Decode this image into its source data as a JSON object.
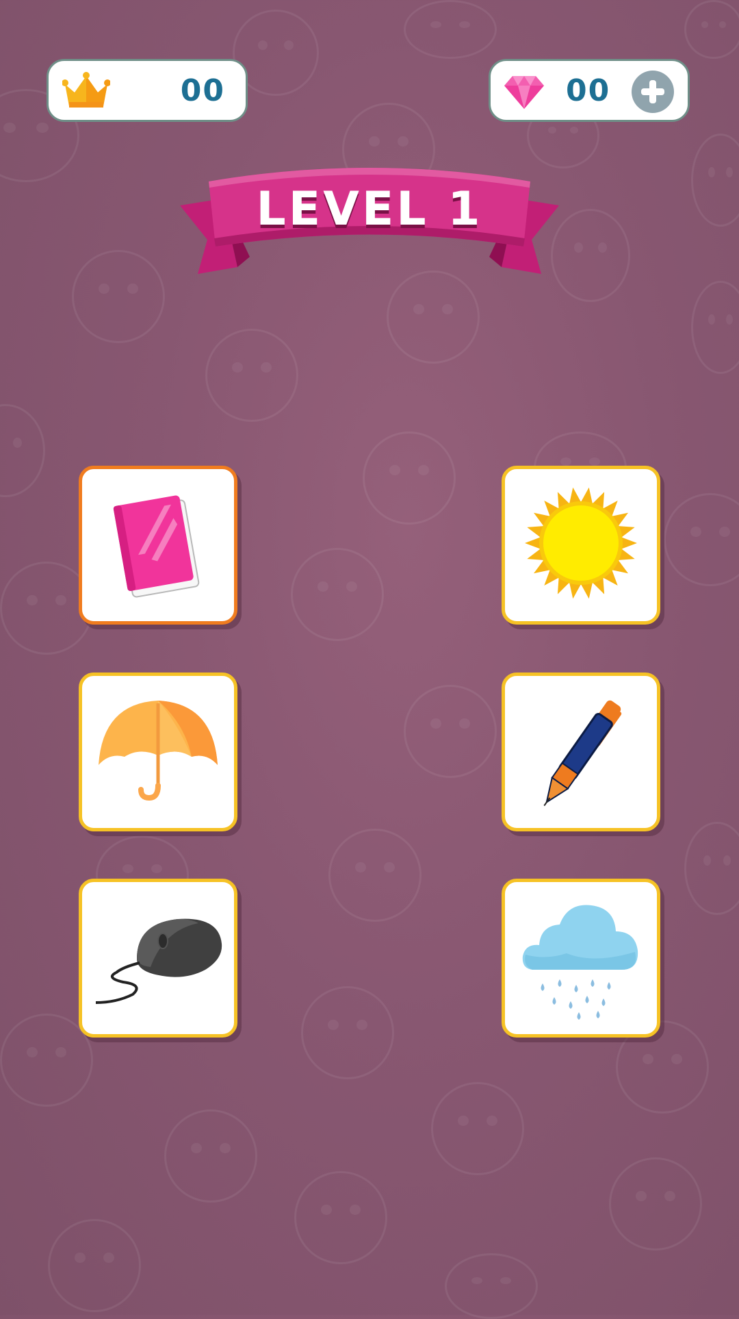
{
  "hud": {
    "crowns": {
      "icon": "crown-icon",
      "value": "00"
    },
    "gems": {
      "icon": "gem-icon",
      "value": "00",
      "add_icon": "plus-icon"
    }
  },
  "level": {
    "title": "LEVEL 1"
  },
  "cards": [
    {
      "icon": "book-icon",
      "selected": true
    },
    {
      "icon": "sun-icon",
      "selected": false
    },
    {
      "icon": "umbrella-icon",
      "selected": false
    },
    {
      "icon": "pen-icon",
      "selected": false
    },
    {
      "icon": "computer-mouse-icon",
      "selected": false
    },
    {
      "icon": "rain-cloud-icon",
      "selected": false
    }
  ],
  "colors": {
    "background": "#885771",
    "card_border": "#f6c225",
    "card_selected_border": "#f07c1f",
    "banner": "#d6338a",
    "counter_text": "#1d6f93"
  }
}
